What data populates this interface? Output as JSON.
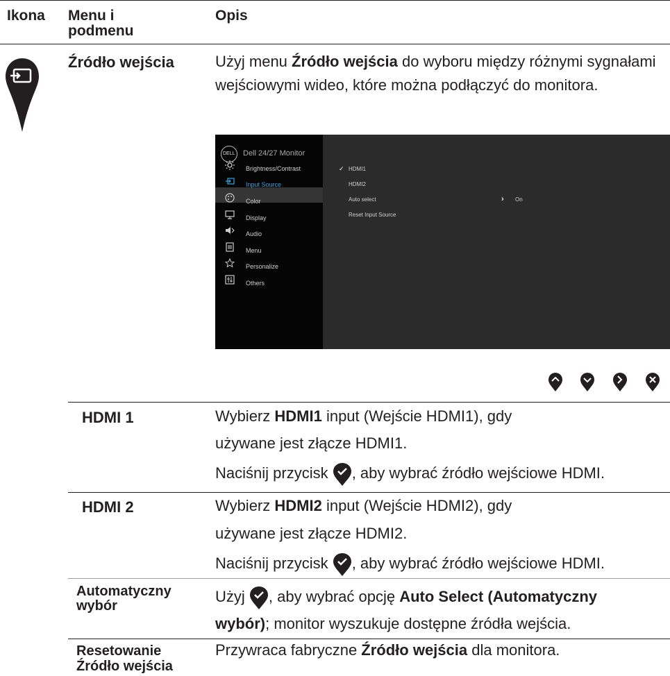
{
  "headers": {
    "icon": "Ikona",
    "menu": "Menu i podmenu",
    "desc": "Opis"
  },
  "main": {
    "icon": "input-source-icon",
    "title": "Źródło wejścia",
    "desc_pre": "Użyj menu ",
    "desc_bold": "Źródło wejścia",
    "desc_post": " do wyboru między różnymi sygnałami wejściowymi wideo, które można podłączyć do monitora."
  },
  "osd": {
    "brand": "DELL",
    "model": "Dell 24/27 Monitor",
    "menu": [
      {
        "label": "Brightness/Contrast",
        "icon": "brightness-icon"
      },
      {
        "label": "Input Source",
        "icon": "input-source-icon"
      },
      {
        "label": "Color",
        "icon": "color-icon"
      },
      {
        "label": "Display",
        "icon": "display-icon"
      },
      {
        "label": "Audio",
        "icon": "audio-icon"
      },
      {
        "label": "Menu",
        "icon": "menu-icon"
      },
      {
        "label": "Personalize",
        "icon": "star-icon"
      },
      {
        "label": "Others",
        "icon": "others-icon"
      }
    ],
    "options": [
      "HDMI1",
      "HDMI2",
      "Auto select",
      "Reset Input Source"
    ],
    "checked": "HDMI1",
    "auto_value": "On",
    "accent": "#2fa8e0"
  },
  "nav_buttons": [
    "up-button-icon",
    "down-button-icon",
    "right-button-icon",
    "close-button-icon"
  ],
  "rows": {
    "hdmi1": {
      "label": "HDMI 1",
      "l1_pre": "Wybierz ",
      "l1_bold": "HDMI1",
      "l1_post": " input (Wejście HDMI1), gdy",
      "l2": "używane jest złącze HDMI1.",
      "l3_pre": "Naciśnij przycisk ",
      "l3_post": ", aby wybrać źródło wejściowe HDMI."
    },
    "hdmi2": {
      "label": "HDMI 2",
      "l1_pre": "Wybierz ",
      "l1_bold": "HDMI2",
      "l1_post": " input (Wejście HDMI2), gdy",
      "l2": "używane jest złącze HDMI2.",
      "l3_pre": "Naciśnij przycisk ",
      "l3_post": ", aby wybrać źródło wejściowe HDMI."
    },
    "auto": {
      "label_1": "Automatyczny",
      "label_2": "wybór",
      "l1_pre": "Użyj ",
      "l1_mid": ", aby wybrać opcję ",
      "l1_bold": "Auto Select (Automatyczny",
      "l2_bold": "wybór)",
      "l2_post": "; monitor wyszukuje dostępne źródła wejścia."
    },
    "reset": {
      "label_1": "Resetowanie",
      "label_2": "Źródło wejścia",
      "l1_pre": "Przywraca fabryczne ",
      "l1_bold": "Źródło wejścia",
      "l1_post": " dla monitora."
    }
  },
  "colors": {
    "button": "#231f20",
    "text": "#231f20"
  }
}
